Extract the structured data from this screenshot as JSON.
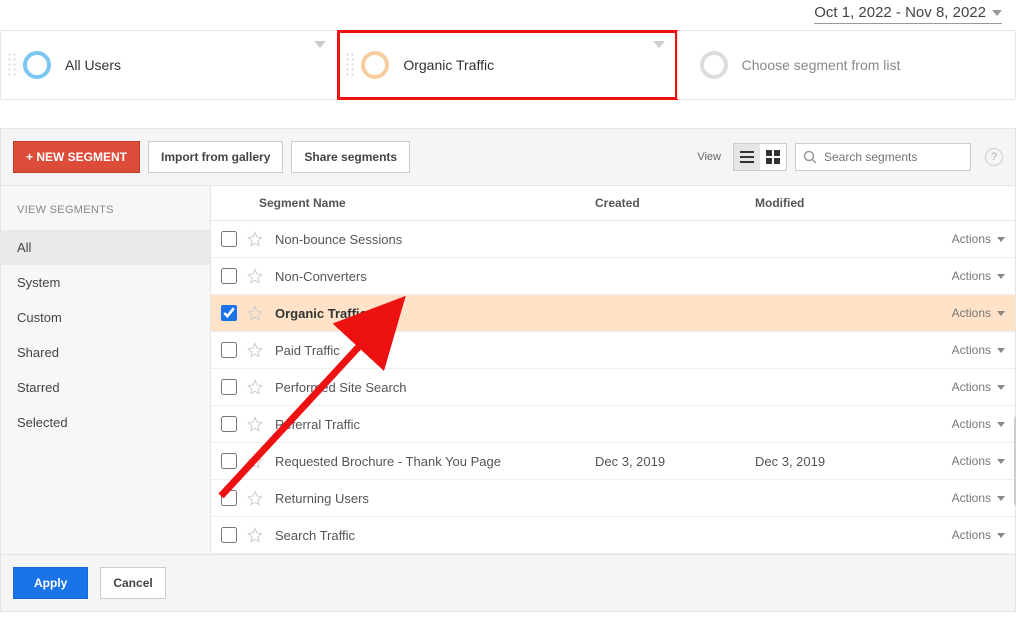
{
  "date_range": "Oct 1, 2022 - Nov 8, 2022",
  "chips": {
    "all_users": "All Users",
    "organic": "Organic Traffic",
    "choose": "Choose segment from list"
  },
  "toolbar": {
    "new_segment": "+ NEW SEGMENT",
    "import": "Import from gallery",
    "share": "Share segments",
    "view_label": "View",
    "search_placeholder": "Search segments",
    "help": "?"
  },
  "sidebar": {
    "heading": "VIEW SEGMENTS",
    "items": [
      "All",
      "System",
      "Custom",
      "Shared",
      "Starred",
      "Selected"
    ],
    "active_index": 0
  },
  "columns": {
    "name": "Segment Name",
    "created": "Created",
    "modified": "Modified",
    "actions": "Actions"
  },
  "rows": [
    {
      "name": "Non-bounce Sessions",
      "created": "",
      "modified": "",
      "checked": false
    },
    {
      "name": "Non-Converters",
      "created": "",
      "modified": "",
      "checked": false
    },
    {
      "name": "Organic Traffic",
      "created": "",
      "modified": "",
      "checked": true
    },
    {
      "name": "Paid Traffic",
      "created": "",
      "modified": "",
      "checked": false
    },
    {
      "name": "Performed Site Search",
      "created": "",
      "modified": "",
      "checked": false
    },
    {
      "name": "Referral Traffic",
      "created": "",
      "modified": "",
      "checked": false
    },
    {
      "name": "Requested Brochure - Thank You Page",
      "created": "Dec 3, 2019",
      "modified": "Dec 3, 2019",
      "checked": false
    },
    {
      "name": "Returning Users",
      "created": "",
      "modified": "",
      "checked": false
    },
    {
      "name": "Search Traffic",
      "created": "",
      "modified": "",
      "checked": false
    }
  ],
  "footer": {
    "apply": "Apply",
    "cancel": "Cancel"
  }
}
